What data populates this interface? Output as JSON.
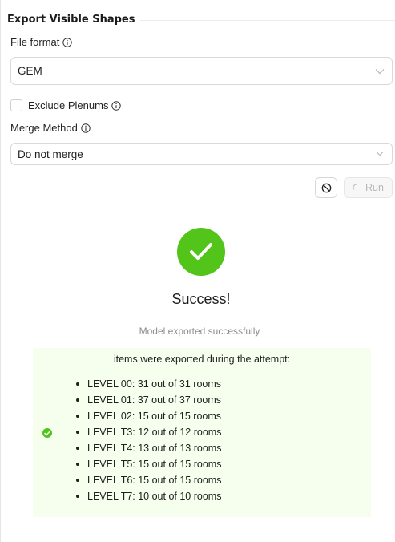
{
  "panel": {
    "title": "Export Visible Shapes"
  },
  "file_format": {
    "label": "File format",
    "value": "GEM"
  },
  "exclude_plenums": {
    "label": "Exclude Plenums",
    "checked": false
  },
  "merge_method": {
    "label": "Merge Method",
    "value": "Do not merge"
  },
  "actions": {
    "cancel_icon": "cancel-icon",
    "run_label": "Run",
    "run_disabled": true
  },
  "result": {
    "title": "Success!",
    "subtitle": "Model exported successfully",
    "heading": "items were exported during the attempt:",
    "status_color": "#52c41a",
    "box_color": "#f6ffed",
    "items": [
      "LEVEL 00: 31 out of 31 rooms",
      "LEVEL 01: 37 out of 37 rooms",
      "LEVEL 02: 15 out of 15 rooms",
      "LEVEL T3: 12 out of 12 rooms",
      "LEVEL T4: 13 out of 13 rooms",
      "LEVEL T5: 15 out of 15 rooms",
      "LEVEL T6: 15 out of 15 rooms",
      "LEVEL T7: 10 out of 10 rooms"
    ]
  }
}
